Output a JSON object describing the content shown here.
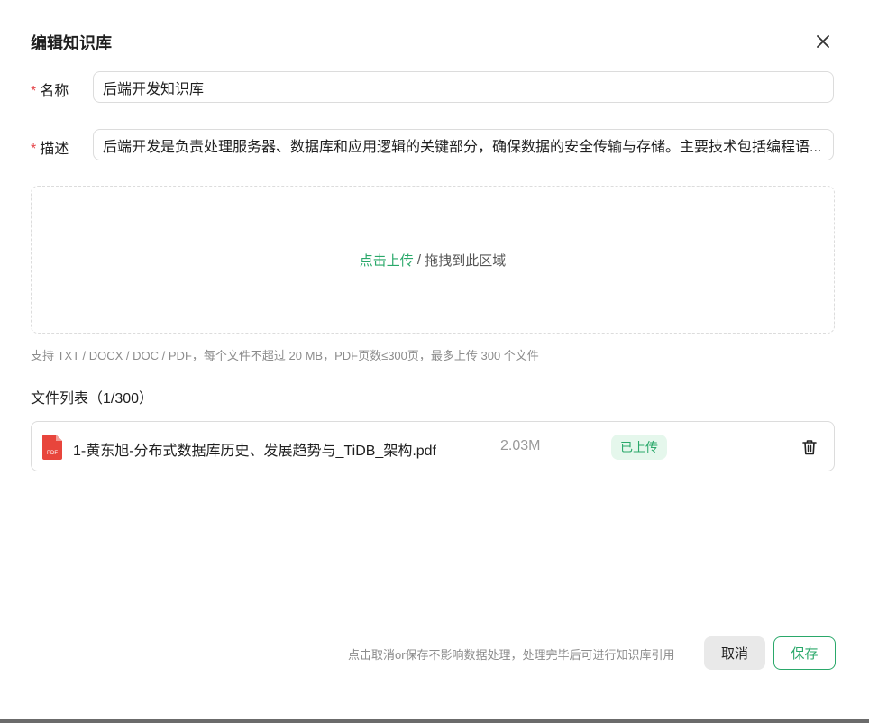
{
  "dialog": {
    "title": "编辑知识库",
    "close_icon": "close-icon"
  },
  "form": {
    "name": {
      "required_mark": "*",
      "label": "名称",
      "value": "后端开发知识库"
    },
    "description": {
      "required_mark": "*",
      "label": "描述",
      "value": "后端开发是负责处理服务器、数据库和应用逻辑的关键部分，确保数据的安全传输与存储。主要技术包括编程语..."
    }
  },
  "upload": {
    "link_text": "点击上传",
    "separator": " / ",
    "drag_text": "拖拽到此区域",
    "hint": "支持 TXT / DOCX / DOC / PDF，每个文件不超过 20 MB，PDF页数≤300页，最多上传 300 个文件"
  },
  "file_list": {
    "title": "文件列表（1/300）",
    "items": [
      {
        "icon": "pdf-file-icon",
        "name": "1-黄东旭-分布式数据库历史、发展趋势与_TiDB_架构.pdf",
        "size": "2.03M",
        "status": "已上传",
        "delete_icon": "trash-icon"
      }
    ]
  },
  "footer": {
    "note": "点击取消or保存不影响数据处理，处理完毕后可进行知识库引用",
    "cancel_label": "取消",
    "save_label": "保存"
  },
  "colors": {
    "accent": "#2aa86a",
    "required": "#e5484d",
    "badge_bg": "#e5f7ec",
    "pdf_red": "#e8453c"
  }
}
